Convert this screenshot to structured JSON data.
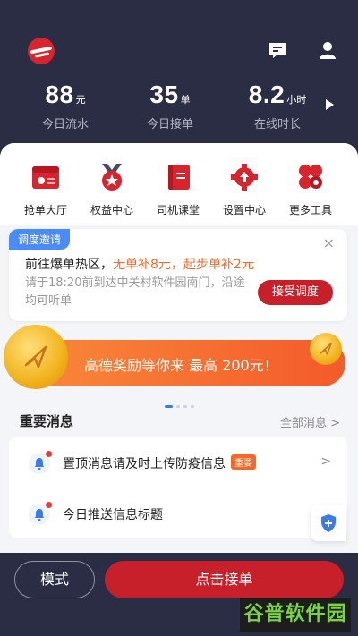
{
  "header": {
    "stats": [
      {
        "value": "88",
        "unit": "元",
        "label": "今日流水"
      },
      {
        "value": "35",
        "unit": "单",
        "label": "今日接单"
      },
      {
        "value": "8.2",
        "unit": "小时",
        "label": "在线时长"
      }
    ],
    "icons": {
      "logo": "brand-logo",
      "message": "message-icon",
      "user": "user-icon",
      "more": "play-icon"
    }
  },
  "tools": [
    {
      "label": "抢单大厅",
      "icon": "order-hall-icon"
    },
    {
      "label": "权益中心",
      "icon": "medal-icon"
    },
    {
      "label": "司机课堂",
      "icon": "book-icon"
    },
    {
      "label": "设置中心",
      "icon": "gear-icon"
    },
    {
      "label": "更多工具",
      "icon": "more-tools-icon"
    }
  ],
  "invite": {
    "tag": "调度邀请",
    "title_prefix": "前往爆单热区，",
    "title_highlight": "无单补8元，起步单补2元",
    "desc": "请于18:20前到达中关村软件园南门，沿途均可听单",
    "accept": "接受调度",
    "close": "×"
  },
  "banner": {
    "text": "高德奖励等你来 最高 200元！",
    "pages": 4,
    "active_page": 1
  },
  "messages": {
    "title": "重要消息",
    "all": "全部消息 >",
    "items": [
      {
        "text": "置顶消息请及时上传防疫信息",
        "badge": "重要",
        "chevron": ">"
      },
      {
        "text": "今日推送信息标题",
        "badge": "",
        "chevron": ""
      }
    ]
  },
  "bottom": {
    "mode": "模式",
    "go": "点击接单"
  },
  "watermark": "谷普软件园",
  "colors": {
    "navy": "#2b2d44",
    "brand_red": "#c8202a",
    "accent_orange": "#f26a2a",
    "blue": "#4a8cf7"
  }
}
